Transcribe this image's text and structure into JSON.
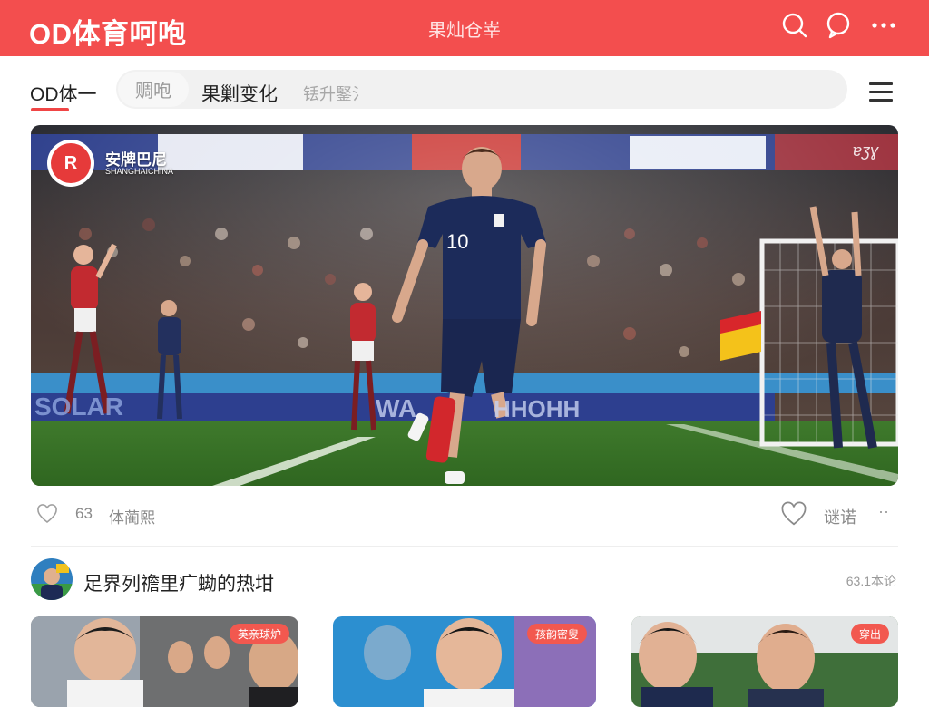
{
  "app": {
    "logo": "OD体育呵咆",
    "center_title": "果灿仓峷"
  },
  "tabs": {
    "active": "OD体一",
    "chip": "赒咆",
    "selected": "果剿变化",
    "placeholder": "铥升鋻氵"
  },
  "hero": {
    "badge": "R",
    "brand": "安牌巴尼",
    "brand_sub": "SHANGHAICHINA",
    "watermark": "ɐʒɣ",
    "jersey_number": "10"
  },
  "actions": {
    "like_count": "63",
    "like_label": "体蔺熙",
    "comment_label": "谜诺",
    "more": "··"
  },
  "section": {
    "title": "足界列䄡里疒蜐的热坩",
    "meta": "63.1本论"
  },
  "cards": [
    {
      "tag": "英亲球炉"
    },
    {
      "tag": "孩韵密叟"
    },
    {
      "tag": "穿出"
    }
  ],
  "colors": {
    "brand_red": "#f34e4e",
    "tag_red": "#f2584f",
    "underline": "#f04545"
  },
  "icons": [
    "search-icon",
    "chat-icon",
    "more-icon",
    "menu-icon",
    "heart-icon"
  ]
}
